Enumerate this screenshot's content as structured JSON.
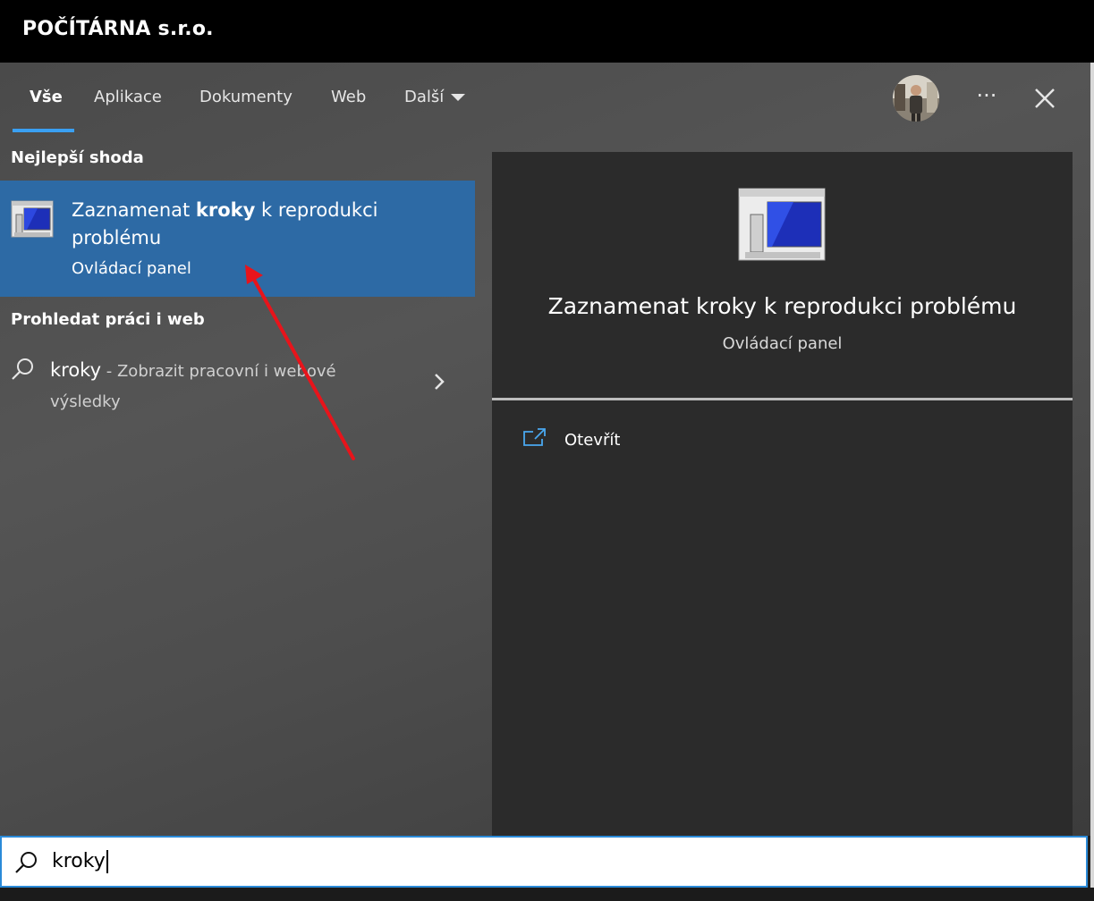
{
  "window": {
    "title": "POČÍTÁRNA s.r.o."
  },
  "tabs": [
    {
      "label": "Vše",
      "active": true
    },
    {
      "label": "Aplikace"
    },
    {
      "label": "Dokumenty"
    },
    {
      "label": "Web"
    },
    {
      "label": "Další"
    }
  ],
  "toolbar": {
    "more_label": "···"
  },
  "sections": {
    "best_match_label": "Nejlepší shoda",
    "search_web_label": "Prohledat práci i web"
  },
  "best_match": {
    "name_before": "Zaznamenat ",
    "name_highlight": "kroky",
    "name_after": " k reprodukci problému",
    "subtitle": "Ovládací panel",
    "icon": "steps-recorder-icon"
  },
  "web_result": {
    "term": "kroky",
    "description": " - Zobrazit pracovní i webové výsledky"
  },
  "preview": {
    "name": "Zaznamenat kroky k reprodukci problému",
    "subtitle": "Ovládací panel",
    "actions": [
      {
        "label": "Otevřít",
        "icon": "open-icon"
      }
    ]
  },
  "search": {
    "value": "kroky"
  },
  "colors": {
    "accent": "#3aa0f3",
    "selection": "#2d6aa5",
    "annotation_arrow": "#e8141b"
  }
}
